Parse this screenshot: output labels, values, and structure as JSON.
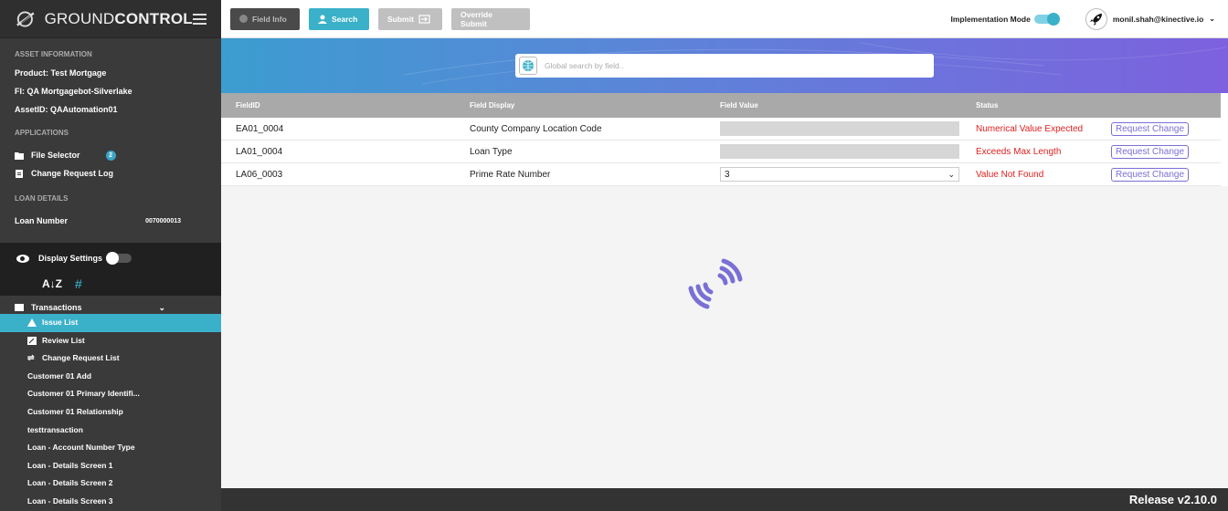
{
  "brand": {
    "name_light": "GROUND",
    "name_bold": "CONTROL"
  },
  "sidebar": {
    "asset_title": "ASSET INFORMATION",
    "product": "Product:  Test Mortgage",
    "fi": "FI:  QA Mortgagebot-Silverlake",
    "asset_id": "AssetID:  QAAutomation01",
    "applications_title": "APPLICATIONS",
    "file_selector": "File Selector",
    "file_selector_badge": "2",
    "change_request_log": "Change Request Log",
    "loan_details_title": "LOAN DETAILS",
    "loan_number_label": "Loan Number",
    "loan_number_value": "0070000013",
    "display_settings": "Display Settings",
    "sort_az": "A↓Z",
    "sort_hash": "#",
    "transactions": "Transactions",
    "nav": [
      {
        "label": "Issue List",
        "icon": "warning-icon"
      },
      {
        "label": "Review List",
        "icon": "review-icon"
      },
      {
        "label": "Change Request List",
        "icon": "change-list-icon"
      }
    ],
    "transactions_items": [
      "Customer 01 Add",
      "Customer 01 Primary Identifi...",
      "Customer 01 Relationship",
      "testtransaction",
      "Loan - Account Number Type",
      "Loan - Details Screen 1",
      "Loan - Details Screen 2",
      "Loan - Details Screen 3"
    ]
  },
  "toolbar": {
    "field_info": "Field Info",
    "search": "Search",
    "submit": "Submit",
    "override_submit": "Override Submit",
    "implementation_mode": "Implementation Mode",
    "user_email": "monil.shah@kinective.io"
  },
  "search": {
    "placeholder": "Global search by field.."
  },
  "table": {
    "headers": [
      "FieldID",
      "Field Display",
      "Field Value",
      "Status",
      ""
    ],
    "request_change_label": "Request Change",
    "rows": [
      {
        "field_id": "EA01_0004",
        "display": "County Company Location Code",
        "value": "",
        "status": "Numerical Value Expected"
      },
      {
        "field_id": "LA01_0004",
        "display": "Loan Type",
        "value": "",
        "status": "Exceeds Max Length"
      },
      {
        "field_id": "LA06_0003",
        "display": "Prime Rate Number",
        "value": "3",
        "status": "Value Not Found"
      }
    ]
  },
  "footer": {
    "release": "Release v2.10.0"
  },
  "colors": {
    "accent": "#3bb0c9",
    "status_error": "#e02020",
    "purple": "#7a6fd6",
    "sidebar_bg": "#3a3a3a"
  }
}
